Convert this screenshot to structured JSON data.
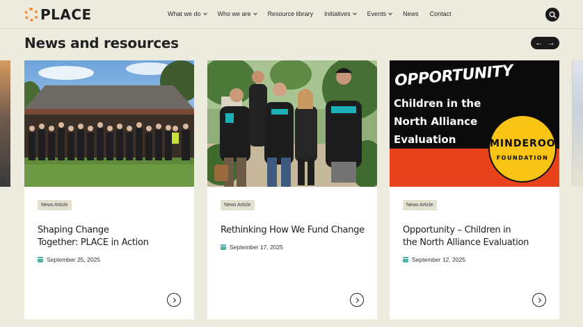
{
  "brand": {
    "name": "PLACE"
  },
  "nav": {
    "items": [
      {
        "label": "What we do",
        "has_dropdown": true
      },
      {
        "label": "Who we are",
        "has_dropdown": true
      },
      {
        "label": "Resource library",
        "has_dropdown": false
      },
      {
        "label": "Initiatives",
        "has_dropdown": true
      },
      {
        "label": "Events",
        "has_dropdown": true
      },
      {
        "label": "News",
        "has_dropdown": false
      },
      {
        "label": "Contact",
        "has_dropdown": false
      }
    ]
  },
  "section": {
    "title": "News and resources"
  },
  "slider": {
    "prev_icon": "arrow-left-icon",
    "next_icon": "arrow-right-icon"
  },
  "cards": [
    {
      "badge": "News Article",
      "title_line1": "Shaping Change",
      "title_line2": "Together: PLACE in Action",
      "date": "September 25, 2025"
    },
    {
      "badge": "News Article",
      "title_line1": "Rethinking How We Fund Change",
      "title_line2": "",
      "date": "September 17, 2025"
    },
    {
      "badge": "News Article",
      "title_line1": "Opportunity – Children in",
      "title_line2": "the North Alliance Evaluation",
      "date": "September 12, 2025",
      "image_text": {
        "headline": "OPPORTUNITY",
        "line1": "Children in the",
        "line2": "North Alliance",
        "line3": "Evaluation",
        "seal_top": "MINDEROO",
        "seal_bottom": "FOUNDATION"
      }
    }
  ],
  "colors": {
    "background": "#edeade",
    "accent_orange": "#f08a3c",
    "calendar_teal": "#4cb3a5",
    "badge_bg": "#e4e0cf",
    "minderoo_yellow": "#f7c315",
    "minderoo_red": "#e8431b"
  }
}
